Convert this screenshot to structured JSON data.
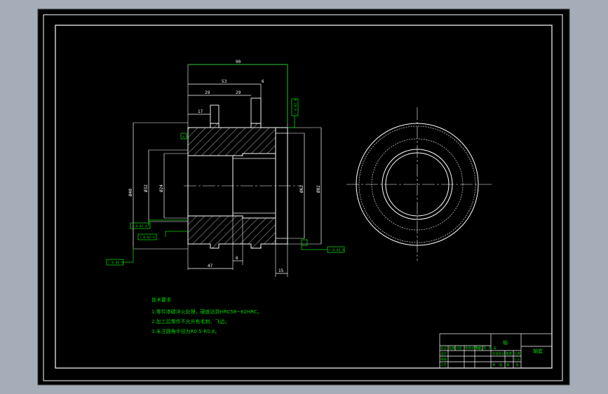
{
  "app": {
    "background_color": "#a5adb8",
    "sheet_color": "#000000",
    "line_color": "#ffffff",
    "dimension_color": "#00d000"
  },
  "drawing": {
    "dims": {
      "overall_length": "90",
      "length_a": "53",
      "length_b": "29",
      "length_c": "29",
      "width_small": "6",
      "depth_small": "17",
      "bottom_left": "47",
      "bottom_mid": "6",
      "bottom_right": "15",
      "dia_a": "Ø40",
      "dia_b": "Ø32",
      "dia_c": "Ø24",
      "dia_d": "Ø82",
      "dia_e": "Ø62"
    },
    "tolerance_boxes": [
      "/ 0.02 A",
      "/ 0.02 A",
      "/ 0.02 A",
      "/ 0.02 A",
      "/ 0.02 A"
    ],
    "datum_label": "A"
  },
  "notes": {
    "heading": "技术要求",
    "items": [
      "1.零件渗碳淬火处理，硬度达到HRC58~62HRC。",
      "2.加工后零件不允许有毛刺、飞边。",
      "3.未注圆角半径为R0.5-R0.8。"
    ]
  },
  "title_block": {
    "part_name": "轴",
    "drawing_number": "轴套",
    "header_cells": [
      "标记",
      "处数",
      "分区",
      "更改文件号",
      "签名",
      "年.月.日"
    ],
    "rows": [
      "设计",
      "审核",
      "工艺"
    ],
    "stage_labels": [
      "阶段标记",
      "重量",
      "比例"
    ],
    "scale": "1:1",
    "sheet_info": [
      "共",
      "张",
      "第",
      "张"
    ]
  }
}
